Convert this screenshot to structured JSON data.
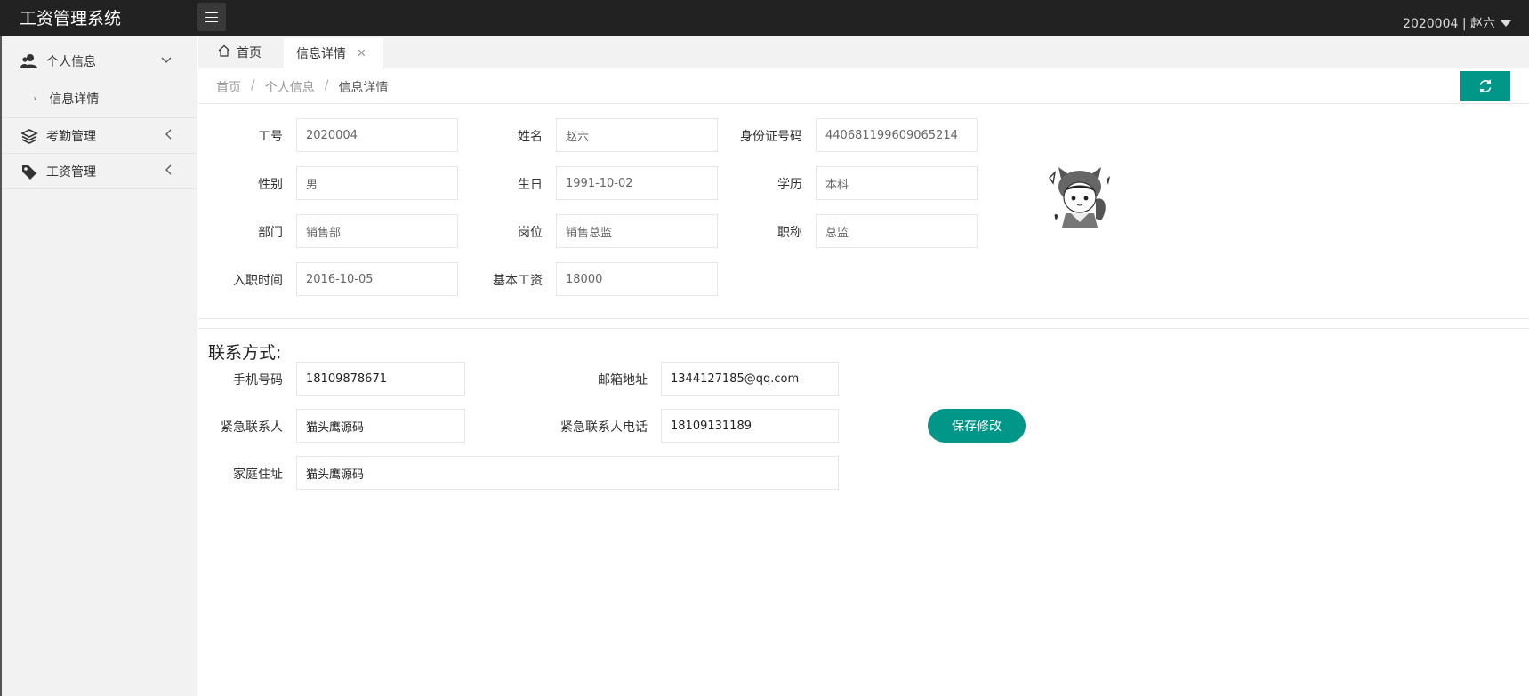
{
  "header": {
    "brand": "工资管理系统",
    "user": "2020004 | 赵六"
  },
  "sidebar": {
    "items": [
      {
        "label": "个人信息",
        "icon": "users-icon",
        "children": [
          {
            "label": "信息详情"
          }
        ]
      },
      {
        "label": "考勤管理",
        "icon": "layers-icon"
      },
      {
        "label": "工资管理",
        "icon": "tag-icon"
      }
    ]
  },
  "tabs": [
    {
      "label": "首页",
      "icon": "home-icon"
    },
    {
      "label": "信息详情",
      "closable": true
    }
  ],
  "breadcrumb": [
    "首页",
    "个人信息",
    "信息详情"
  ],
  "basic_info": {
    "emp_id": {
      "label": "工号",
      "value": "2020004"
    },
    "name": {
      "label": "姓名",
      "value": "赵六"
    },
    "id_card": {
      "label": "身份证号码",
      "value": "440681199609065214"
    },
    "gender": {
      "label": "性别",
      "value": "男"
    },
    "birthday": {
      "label": "生日",
      "value": "1991-10-02"
    },
    "education": {
      "label": "学历",
      "value": "本科"
    },
    "department": {
      "label": "部门",
      "value": "销售部"
    },
    "position": {
      "label": "岗位",
      "value": "销售总监"
    },
    "title": {
      "label": "职称",
      "value": "总监"
    },
    "hire_date": {
      "label": "入职时间",
      "value": "2016-10-05"
    },
    "base_salary": {
      "label": "基本工资",
      "value": "18000"
    }
  },
  "contact": {
    "section_title": "联系方式:",
    "phone": {
      "label": "手机号码",
      "value": "18109878671"
    },
    "email": {
      "label": "邮箱地址",
      "value": "1344127185@qq.com"
    },
    "emergency_contact": {
      "label": "紧急联系人",
      "value": "猫头鹰源码"
    },
    "emergency_phone": {
      "label": "紧急联系人电话",
      "value": "18109131189"
    },
    "address": {
      "label": "家庭住址",
      "value": "猫头鹰源码"
    },
    "save_label": "保存修改"
  },
  "colors": {
    "accent": "#009688",
    "header_bg": "#222222",
    "sidebar_bg": "#f2f2f2"
  }
}
